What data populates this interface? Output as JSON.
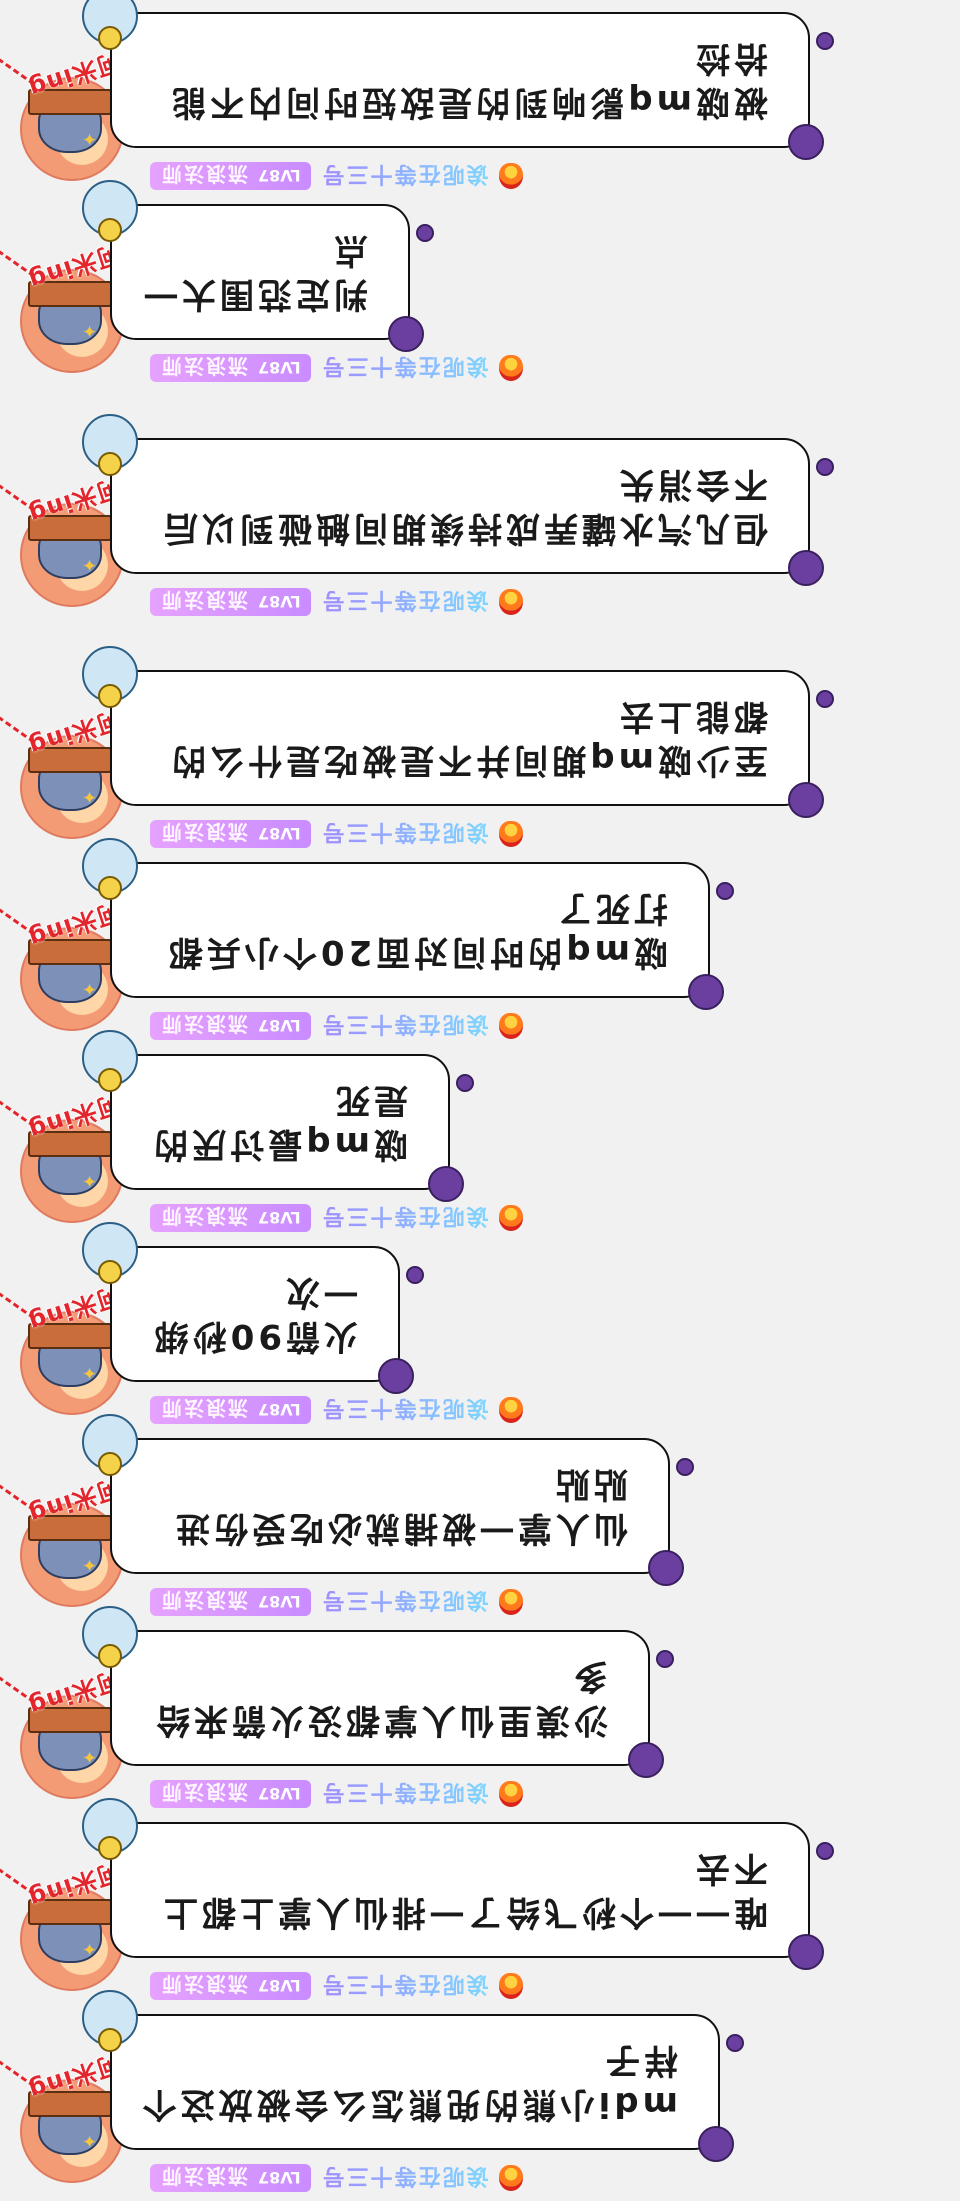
{
  "sender": {
    "nickname": "诶呢在等十三号",
    "level": "LV87",
    "title": "流浪法师",
    "avatar_tag": "阿米ing"
  },
  "messages": [
    {
      "text": "mdi小熊的兜熊怎么会被放这个样子"
    },
    {
      "text": "唯一一个秒飞给了一排仙人掌上都上不去"
    },
    {
      "text": "沙漠里仙人掌都没火箭来给多"
    },
    {
      "text": "仙人掌一被捕就必吃受伤进贴贴"
    },
    {
      "text": "火箭90秒绑一次"
    },
    {
      "text": "啵mq最讨厌的是死"
    },
    {
      "text": "啵mq的时间对面20个小兵都打死了"
    },
    {
      "text": "至少啵mq期间并不是被吃是什么的都能上去"
    },
    {
      "text": "但凡汽水罐弄成持续期间触碰到以后不会消失"
    },
    {
      "text": "判定范围大一点"
    },
    {
      "text": "被啵mq影响到的是敌短时间内不能拾捡"
    }
  ]
}
